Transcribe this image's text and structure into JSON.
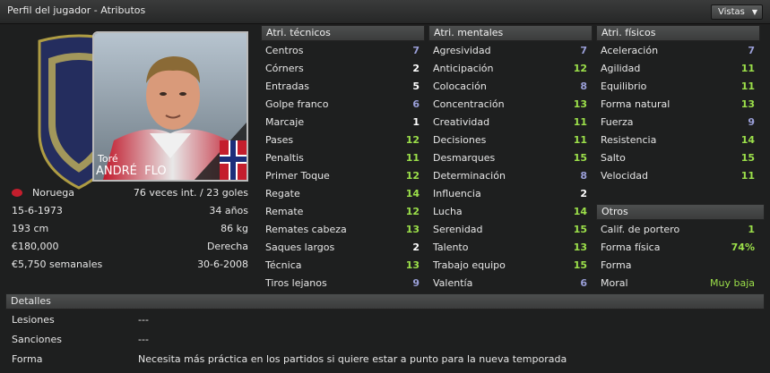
{
  "window": {
    "title": "Perfil del jugador - Atributos",
    "views_label": "Vistas"
  },
  "player": {
    "nickname": "Toré",
    "name": "ANDRÉ  FLO",
    "nationality": "Noruega",
    "caps": "76 veces int. / 23 goles",
    "dob": "15-6-1973",
    "age": "34 años",
    "height": "193 cm",
    "weight": "86 kg",
    "value": "€180,000",
    "foot": "Derecha",
    "wage": "€5,750 semanales",
    "contract": "30-6-2008"
  },
  "technical": {
    "header": "Atri. técnicos",
    "rows": [
      {
        "label": "Centros",
        "value": "7",
        "color": "blue"
      },
      {
        "label": "Córners",
        "value": "2",
        "color": "white"
      },
      {
        "label": "Entradas",
        "value": "5",
        "color": "white"
      },
      {
        "label": "Golpe franco",
        "value": "6",
        "color": "blue"
      },
      {
        "label": "Marcaje",
        "value": "1",
        "color": "white"
      },
      {
        "label": "Pases",
        "value": "12",
        "color": "green"
      },
      {
        "label": "Penaltis",
        "value": "11",
        "color": "green"
      },
      {
        "label": "Primer Toque",
        "value": "12",
        "color": "green"
      },
      {
        "label": "Regate",
        "value": "14",
        "color": "green"
      },
      {
        "label": "Remate",
        "value": "12",
        "color": "green"
      },
      {
        "label": "Remates cabeza",
        "value": "13",
        "color": "green"
      },
      {
        "label": "Saques largos",
        "value": "2",
        "color": "white"
      },
      {
        "label": "Técnica",
        "value": "13",
        "color": "green"
      },
      {
        "label": "Tiros lejanos",
        "value": "9",
        "color": "blue"
      }
    ]
  },
  "mental": {
    "header": "Atri. mentales",
    "rows": [
      {
        "label": "Agresividad",
        "value": "7",
        "color": "blue"
      },
      {
        "label": "Anticipación",
        "value": "12",
        "color": "green"
      },
      {
        "label": "Colocación",
        "value": "8",
        "color": "blue"
      },
      {
        "label": "Concentración",
        "value": "13",
        "color": "green"
      },
      {
        "label": "Creatividad",
        "value": "11",
        "color": "green"
      },
      {
        "label": "Decisiones",
        "value": "11",
        "color": "green"
      },
      {
        "label": "Desmarques",
        "value": "15",
        "color": "green"
      },
      {
        "label": "Determinación",
        "value": "8",
        "color": "blue"
      },
      {
        "label": "Influencia",
        "value": "2",
        "color": "white"
      },
      {
        "label": "Lucha",
        "value": "14",
        "color": "green"
      },
      {
        "label": "Serenidad",
        "value": "15",
        "color": "green"
      },
      {
        "label": "Talento",
        "value": "13",
        "color": "green"
      },
      {
        "label": "Trabajo equipo",
        "value": "15",
        "color": "green"
      },
      {
        "label": "Valentía",
        "value": "6",
        "color": "blue"
      }
    ]
  },
  "physical": {
    "header": "Atri. físicos",
    "rows": [
      {
        "label": "Aceleración",
        "value": "7",
        "color": "blue"
      },
      {
        "label": "Agilidad",
        "value": "11",
        "color": "green"
      },
      {
        "label": "Equilibrio",
        "value": "11",
        "color": "green"
      },
      {
        "label": "Forma natural",
        "value": "13",
        "color": "green"
      },
      {
        "label": "Fuerza",
        "value": "9",
        "color": "blue"
      },
      {
        "label": "Resistencia",
        "value": "14",
        "color": "green"
      },
      {
        "label": "Salto",
        "value": "15",
        "color": "green"
      },
      {
        "label": "Velocidad",
        "value": "11",
        "color": "green"
      }
    ]
  },
  "others": {
    "header": "Otros",
    "rows": [
      {
        "label": "Calif. de portero",
        "value": "1",
        "color": "green"
      },
      {
        "label": "Forma física",
        "value": "74%",
        "color": "green"
      },
      {
        "label": "Forma",
        "value": "",
        "color": "white"
      },
      {
        "label": "Moral",
        "value": "Muy baja",
        "color": "green"
      }
    ]
  },
  "details": {
    "header": "Detalles",
    "rows": [
      {
        "label": "Lesiones",
        "value": "---"
      },
      {
        "label": "Sanciones",
        "value": "---"
      },
      {
        "label": "Forma",
        "value": "Necesita más práctica en los partidos si quiere estar a punto para la nueva temporada"
      }
    ]
  },
  "colors": {
    "blue": "#9a9fd8",
    "white": "#ffffff",
    "green": "#9ce04a"
  }
}
